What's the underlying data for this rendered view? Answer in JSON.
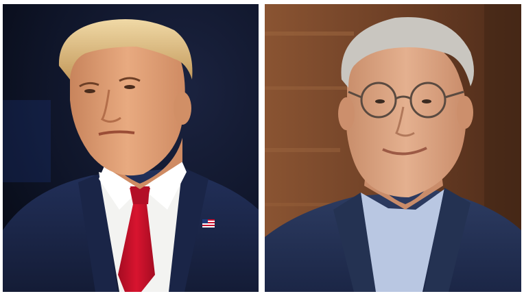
{
  "photos": [
    {
      "id": "left",
      "subject": "man-in-suit-red-tie"
    },
    {
      "id": "right",
      "subject": "man-with-glasses-navy-blazer"
    }
  ],
  "colors": {
    "left_background": "#0d1425",
    "right_background": "#7a4a2c",
    "red_tie": "#c8102e",
    "navy_suit": "#1c2847",
    "right_blazer": "#243252",
    "right_shirt": "#b9c7e2",
    "blond_hair": "#d8b77a",
    "gray_hair": "#c9c6c0",
    "skin_left": "#e2a47c",
    "skin_right": "#d9a27e"
  }
}
